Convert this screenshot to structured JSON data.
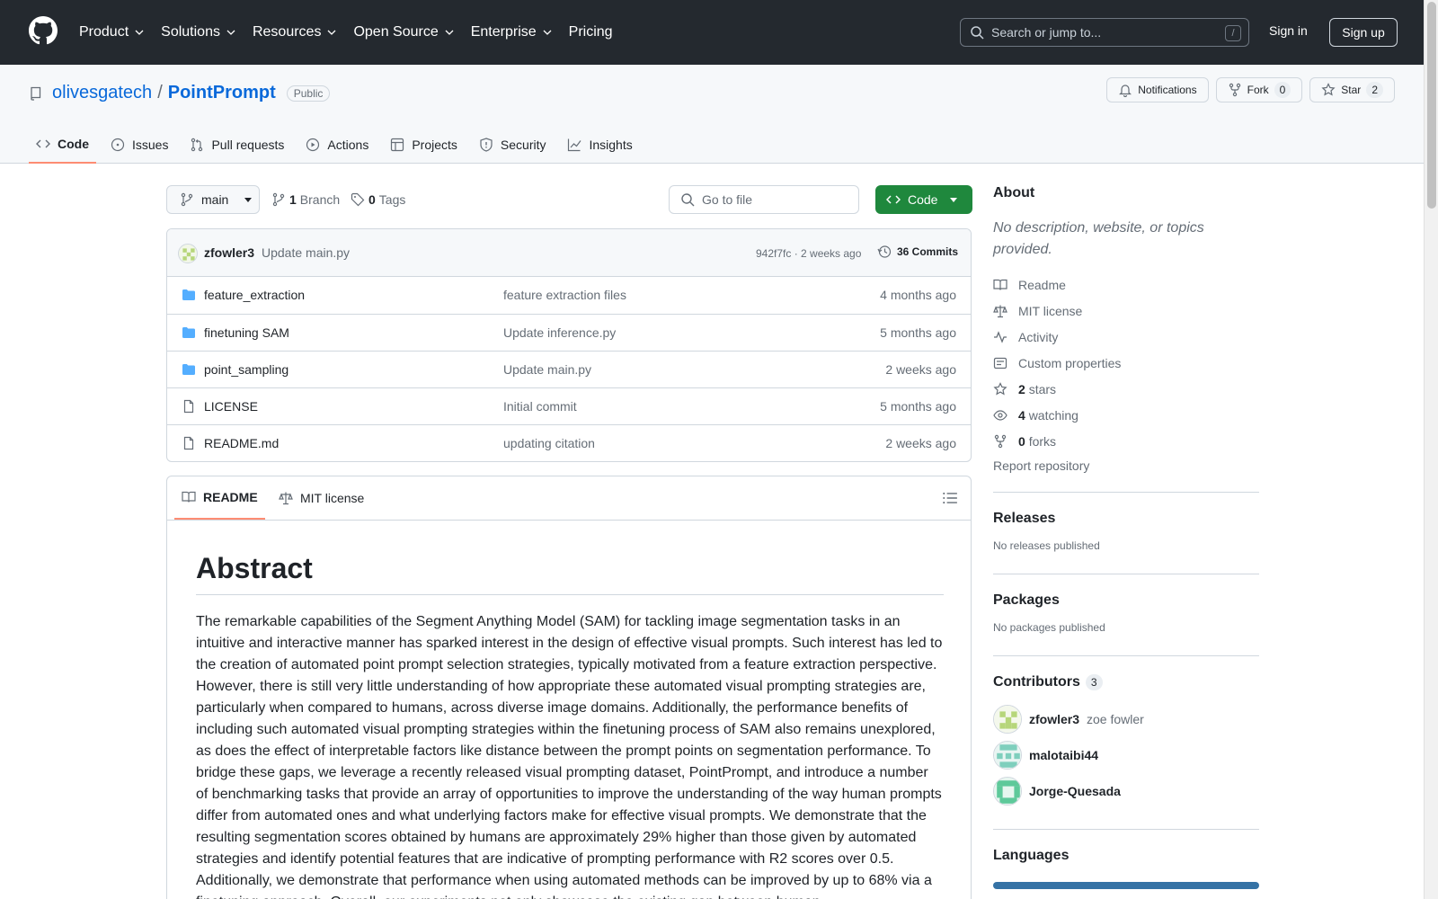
{
  "header": {
    "nav": [
      {
        "label": "Product"
      },
      {
        "label": "Solutions"
      },
      {
        "label": "Resources"
      },
      {
        "label": "Open Source"
      },
      {
        "label": "Enterprise"
      },
      {
        "label": "Pricing"
      }
    ],
    "search_placeholder": "Search or jump to...",
    "search_shortcut": "/",
    "signin_label": "Sign in",
    "signup_label": "Sign up"
  },
  "repo": {
    "owner": "olivesgatech",
    "separator": "/",
    "name": "PointPrompt",
    "visibility": "Public",
    "notifications_label": "Notifications",
    "fork_label": "Fork",
    "fork_count": "0",
    "star_label": "Star",
    "star_count": "2",
    "tabs": [
      {
        "label": "Code",
        "icon": "code-icon",
        "active": true
      },
      {
        "label": "Issues",
        "icon": "issue-icon"
      },
      {
        "label": "Pull requests",
        "icon": "pull-request-icon"
      },
      {
        "label": "Actions",
        "icon": "play-icon"
      },
      {
        "label": "Projects",
        "icon": "table-icon"
      },
      {
        "label": "Security",
        "icon": "shield-icon"
      },
      {
        "label": "Insights",
        "icon": "graph-icon"
      }
    ]
  },
  "toolbar": {
    "branch": "main",
    "branch_count": "1",
    "branch_label": "Branch",
    "tag_count": "0",
    "tag_label": "Tags",
    "goto_placeholder": "Go to file",
    "code_label": "Code"
  },
  "latest_commit": {
    "author": "zfowler3",
    "message": "Update main.py",
    "hash_time": "942f7fc · 2 weeks ago",
    "commits_label": "36 Commits"
  },
  "files": [
    {
      "type": "folder",
      "name": "feature_extraction",
      "message": "feature extraction files",
      "date": "4 months ago"
    },
    {
      "type": "folder",
      "name": "finetuning SAM",
      "message": "Update inference.py",
      "date": "5 months ago"
    },
    {
      "type": "folder",
      "name": "point_sampling",
      "message": "Update main.py",
      "date": "2 weeks ago"
    },
    {
      "type": "file",
      "name": "LICENSE",
      "message": "Initial commit",
      "date": "5 months ago"
    },
    {
      "type": "file",
      "name": "README.md",
      "message": "updating citation",
      "date": "2 weeks ago"
    }
  ],
  "readme": {
    "tab_readme": "README",
    "tab_license": "MIT license",
    "title": "Abstract",
    "body": "The remarkable capabilities of the Segment Anything Model (SAM) for tackling image segmentation tasks in an intuitive and interactive manner has sparked interest in the design of effective visual prompts. Such interest has led to the creation of automated point prompt selection strategies, typically motivated from a feature extraction perspective. However, there is still very little understanding of how appropriate these automated visual prompting strategies are, particularly when compared to humans, across diverse image domains. Additionally, the performance benefits of including such automated visual prompting strategies within the finetuning process of SAM also remains unexplored, as does the effect of interpretable factors like distance between the prompt points on segmentation performance. To bridge these gaps, we leverage a recently released visual prompting dataset, PointPrompt, and introduce a number of benchmarking tasks that provide an array of opportunities to improve the understanding of the way human prompts differ from automated ones and what underlying factors make for effective visual prompts. We demonstrate that the resulting segmentation scores obtained by humans are approximately 29% higher than those given by automated strategies and identify potential features that are indicative of prompting performance with R2 scores over 0.5. Additionally, we demonstrate that performance when using automated methods can be improved by up to 68% via a finetuning approach. Overall, our experiments not only showcase the existing gap between human"
  },
  "sidebar": {
    "about_title": "About",
    "about_desc": "No description, website, or topics provided.",
    "items": [
      {
        "icon": "book-icon",
        "label": "Readme"
      },
      {
        "icon": "law-icon",
        "label": "MIT license"
      },
      {
        "icon": "pulse-icon",
        "label": "Activity"
      },
      {
        "icon": "note-icon",
        "label": "Custom properties"
      },
      {
        "icon": "star-icon",
        "count": "2",
        "label": "stars"
      },
      {
        "icon": "eye-icon",
        "count": "4",
        "label": "watching"
      },
      {
        "icon": "fork-icon",
        "count": "0",
        "label": "forks"
      }
    ],
    "report": "Report repository",
    "releases_title": "Releases",
    "releases_note": "No releases published",
    "packages_title": "Packages",
    "packages_note": "No packages published",
    "contributors_title": "Contributors",
    "contributors_count": "3",
    "contributors": [
      {
        "login": "zfowler3",
        "name": "zoe fowler"
      },
      {
        "login": "malotaibi44",
        "name": ""
      },
      {
        "login": "Jorge-Quesada",
        "name": ""
      }
    ],
    "languages_title": "Languages",
    "colors": {
      "accent": "#0969da",
      "green": "#1f883d",
      "tab_underline": "#fd8c73",
      "language_bar": "#3572A5"
    }
  }
}
